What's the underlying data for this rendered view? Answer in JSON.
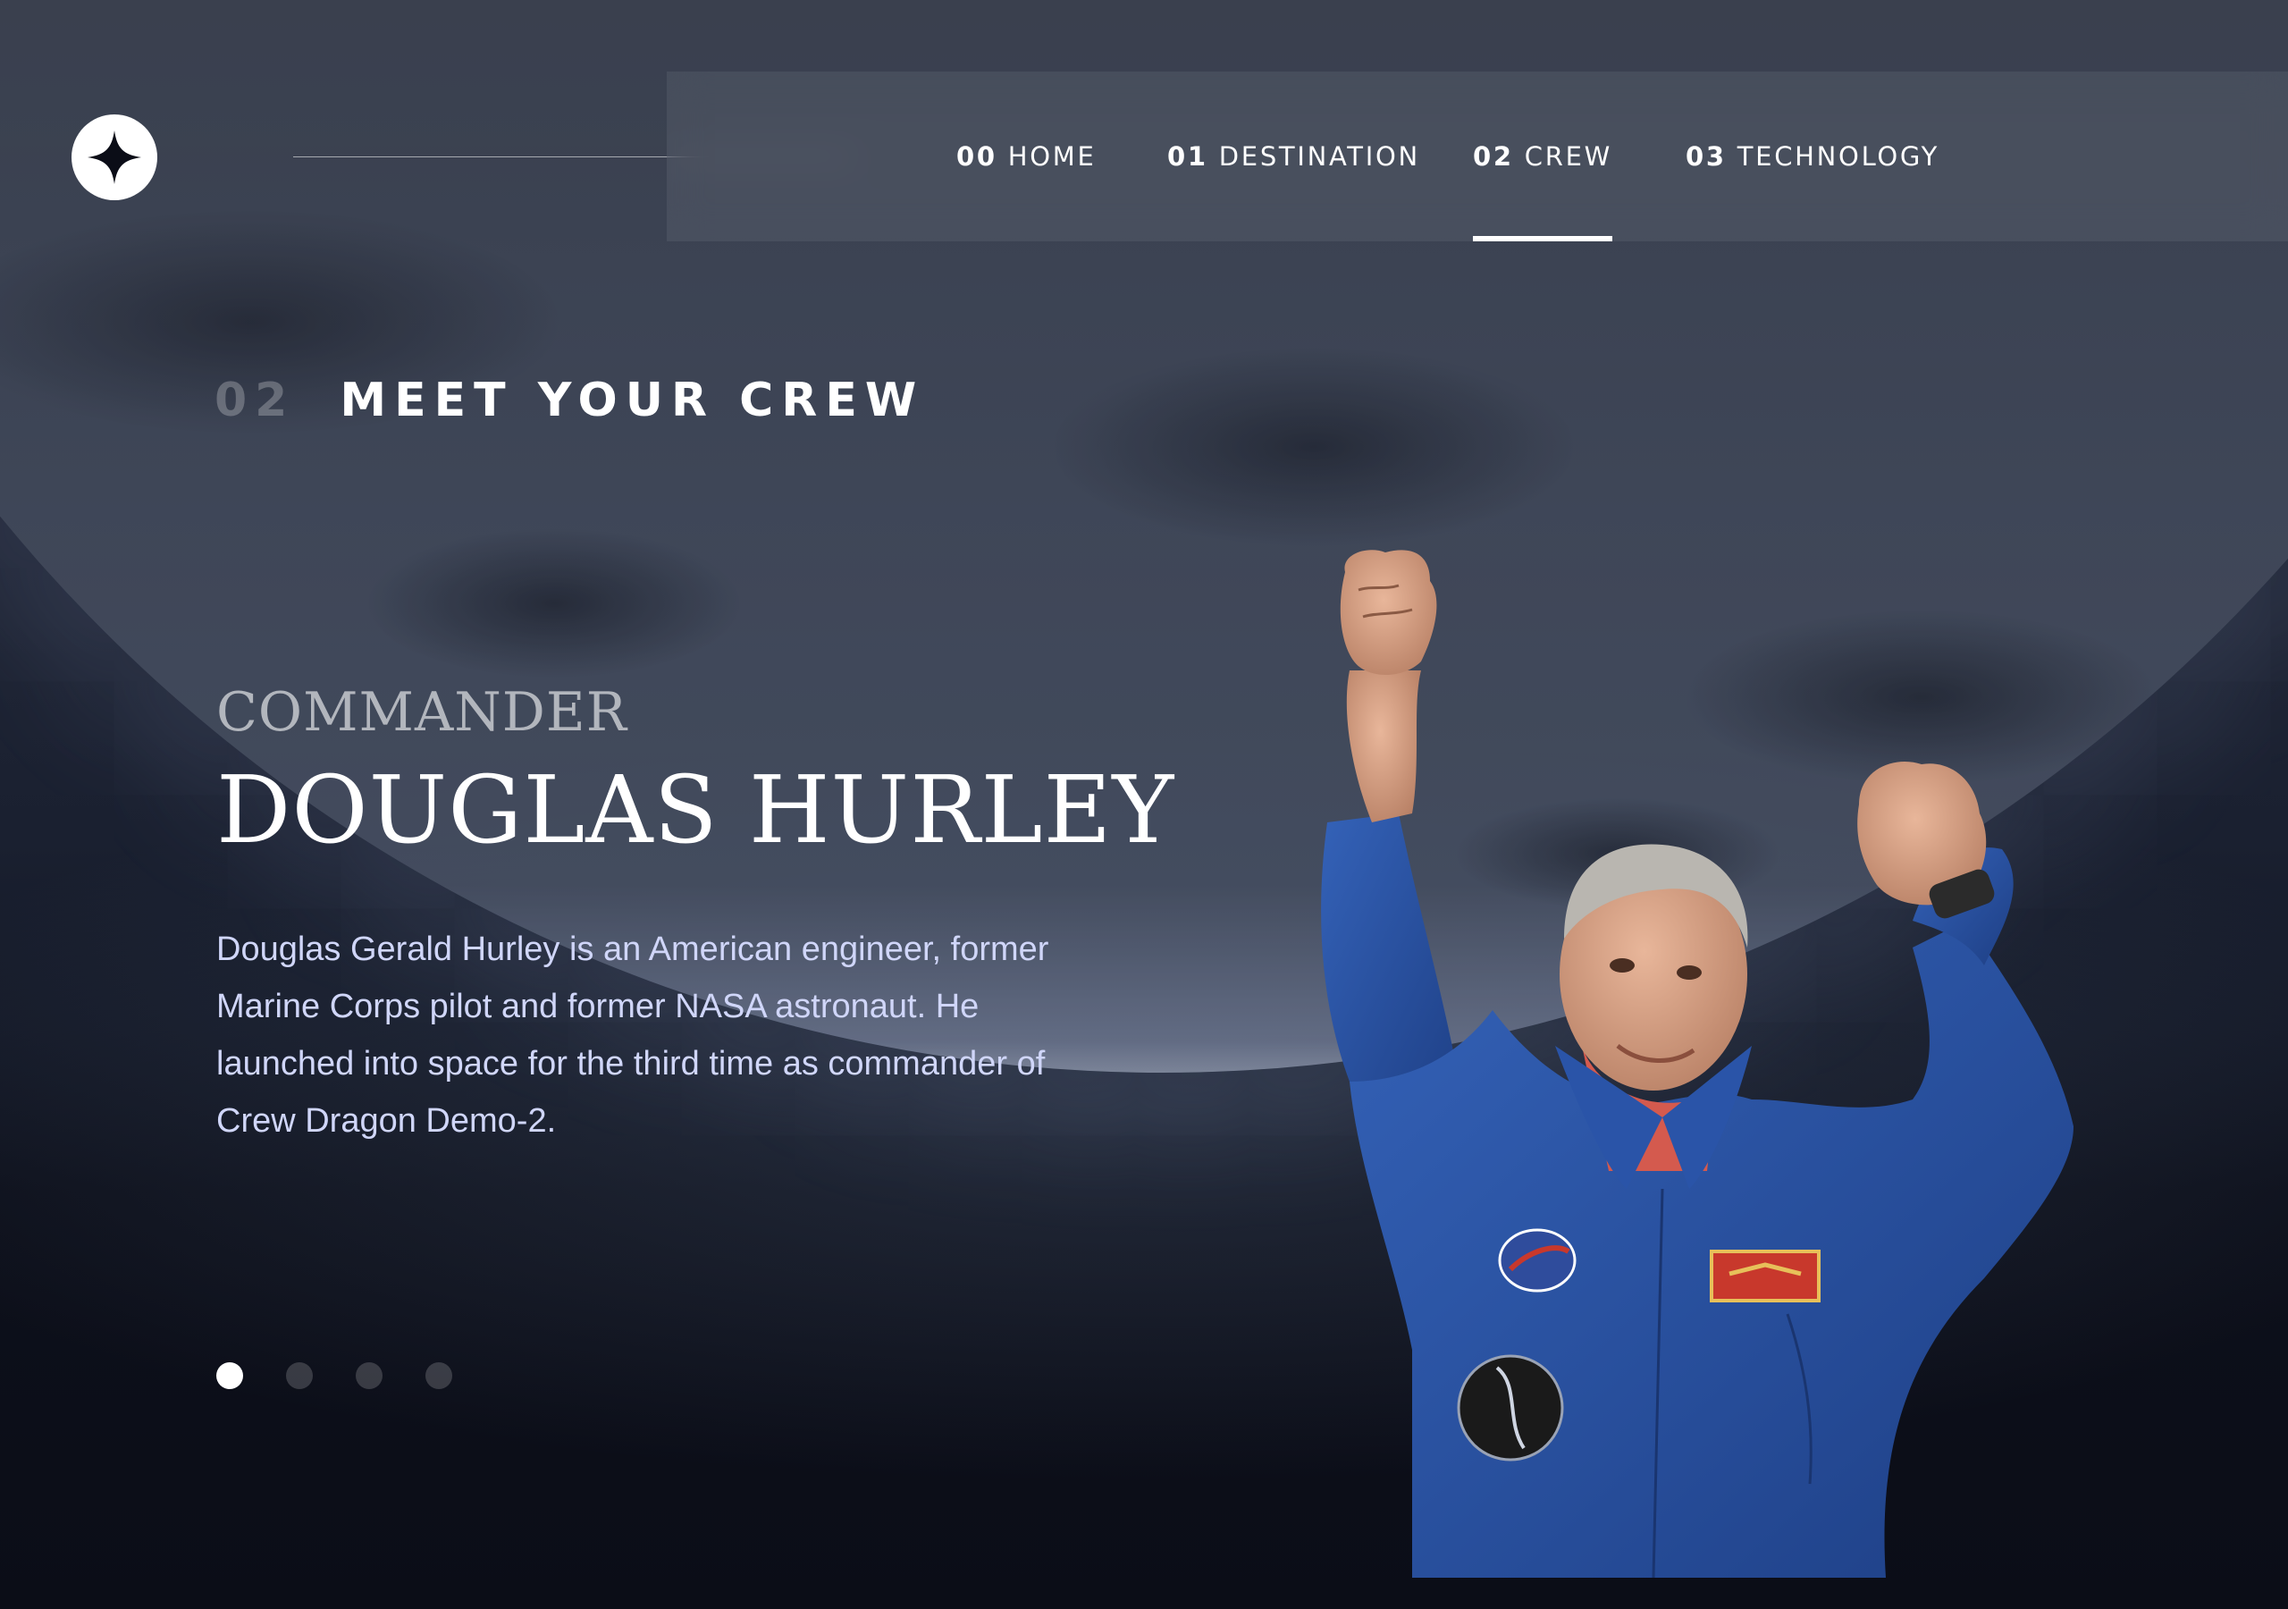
{
  "nav": {
    "items": [
      {
        "num": "00",
        "label": "HOME",
        "active": false
      },
      {
        "num": "01",
        "label": "DESTINATION",
        "active": false
      },
      {
        "num": "02",
        "label": "CREW",
        "active": true
      },
      {
        "num": "03",
        "label": "TECHNOLOGY",
        "active": false
      }
    ]
  },
  "heading": {
    "num": "02",
    "title": "MEET YOUR CREW"
  },
  "crew": {
    "role": "COMMANDER",
    "name": "DOUGLAS HURLEY",
    "bio": "Douglas Gerald Hurley is an American engineer, former Marine Corps pilot and former NASA astronaut. He launched into space for the third time as commander of Crew Dragon Demo-2.",
    "slider": {
      "count": 4,
      "active_index": 0
    }
  },
  "colors": {
    "background": "#0b0d17",
    "bio_text": "#d0d6f9",
    "suit": "#2a54a8",
    "nasa_patch": "#c8382c"
  },
  "icons": {
    "logo": "star-logo-icon"
  }
}
